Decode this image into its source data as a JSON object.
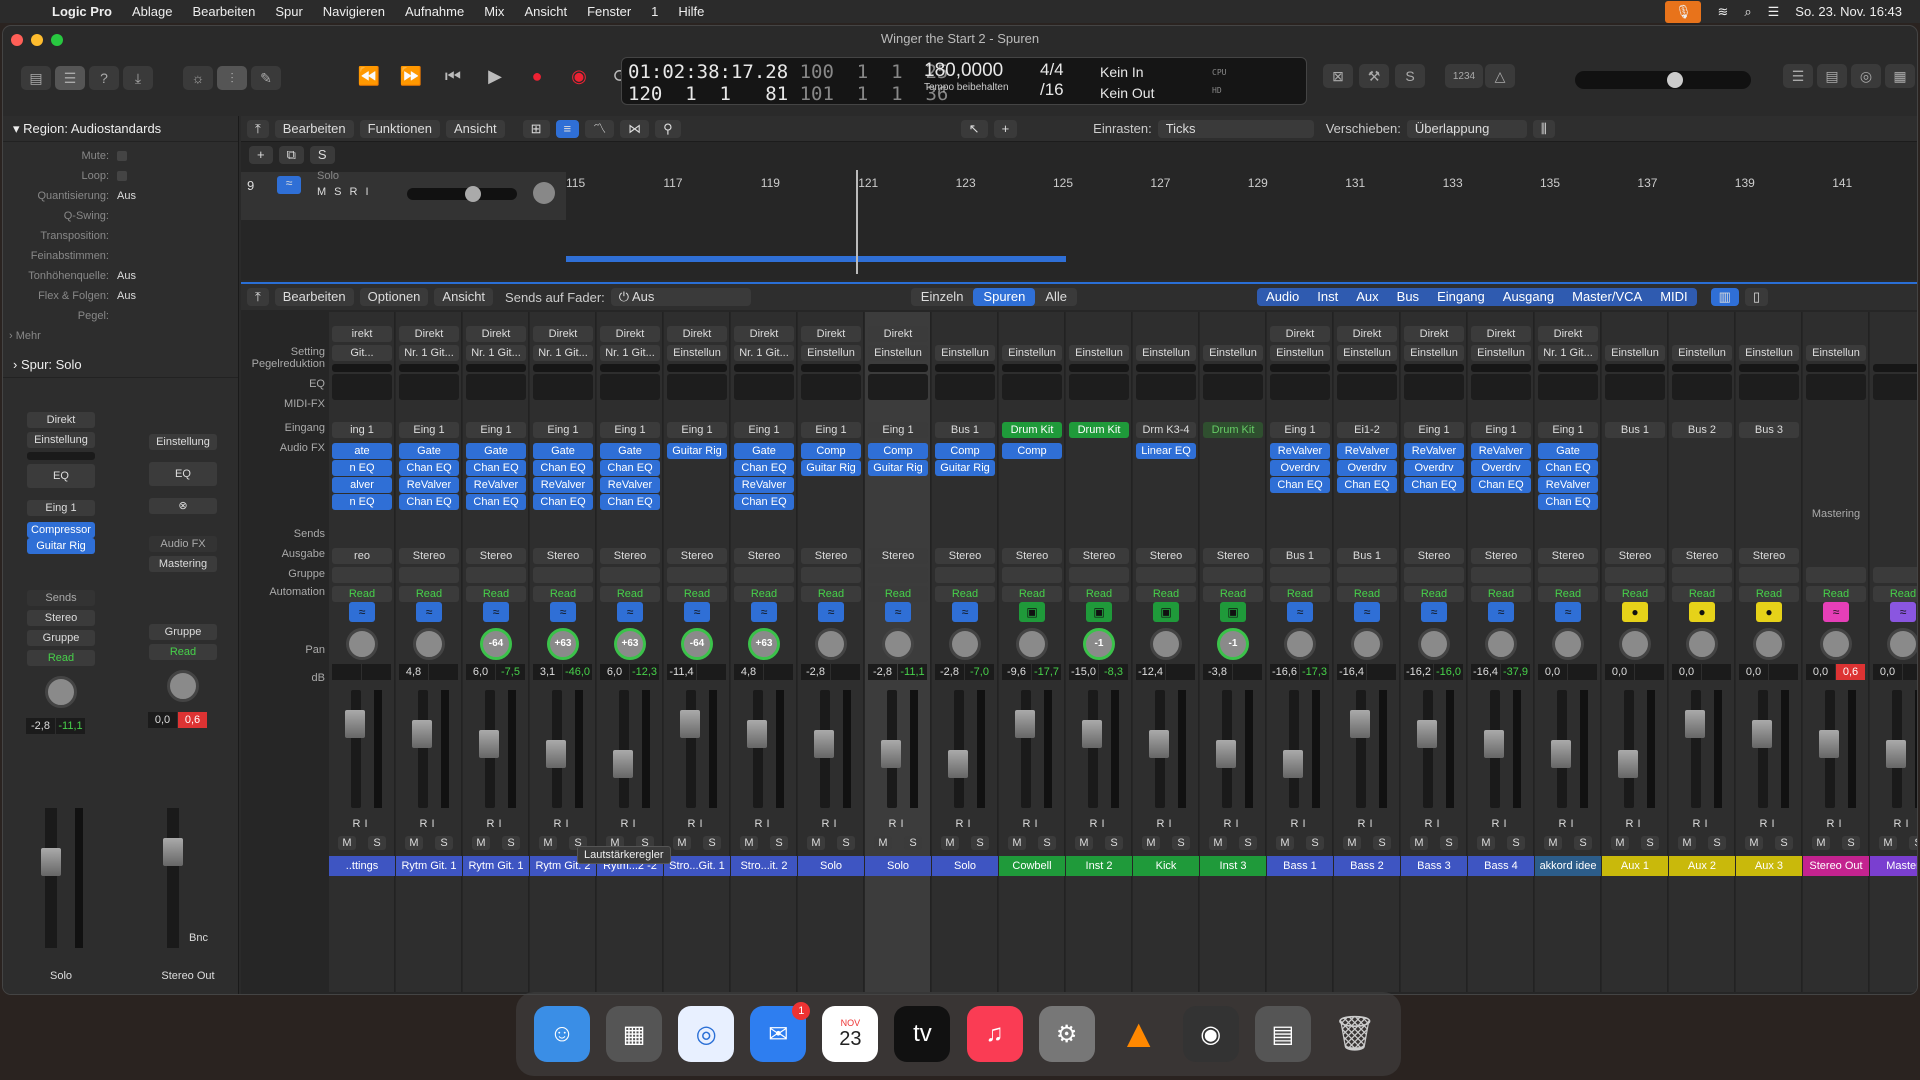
{
  "menubar": {
    "app": "Logic Pro",
    "items": [
      "Ablage",
      "Bearbeiten",
      "Spur",
      "Navigieren",
      "Aufnahme",
      "Mix",
      "Ansicht",
      "Fenster",
      "1",
      "Hilfe"
    ],
    "datetime": "So. 23. Nov.  16:43"
  },
  "window": {
    "title": "Winger the Start 2 - Spuren"
  },
  "lcd": {
    "position": "01:02:38:17.28",
    "bars": "120  1  1   81",
    "bars2a": "100  1  1  25",
    "bars2b": "101  1  1  36",
    "tempo": "180,0000",
    "tempo_mode": "Tempo beibehalten",
    "sig_top": "4/4",
    "sig_bot": "/16",
    "in": "Kein In",
    "out": "Kein Out",
    "cpu": "CPU",
    "hd": "HD"
  },
  "toolbar": {
    "count": "1234"
  },
  "region": {
    "title": "Region: Audiostandards",
    "rows": [
      {
        "k": "Mute:",
        "v": ""
      },
      {
        "k": "Loop:",
        "v": ""
      },
      {
        "k": "Quantisierung:",
        "v": "Aus"
      },
      {
        "k": "Q-Swing:",
        "v": ""
      },
      {
        "k": "Transposition:",
        "v": ""
      },
      {
        "k": "Feinabstimmen:",
        "v": ""
      },
      {
        "k": "Tonhöhenquelle:",
        "v": "Aus"
      },
      {
        "k": "Flex & Folgen:",
        "v": "Aus"
      },
      {
        "k": "Pegel:",
        "v": ""
      }
    ],
    "more": "Mehr",
    "track": "Spur:  Solo"
  },
  "inspector": {
    "s1": {
      "direkt": "Direkt",
      "setting": "Einstellung",
      "eq": "EQ",
      "input": "Eing 1",
      "fx1": "Compressor",
      "fx2": "Guitar Rig",
      "sends": "Sends",
      "out": "Stereo",
      "group": "Gruppe",
      "read": "Read",
      "db1": "-2,8",
      "db2": "-11,1",
      "name": "Solo"
    },
    "s2": {
      "setting": "Einstellung",
      "eq": "EQ",
      "audiofx": "Audio FX",
      "fx1": "Mastering",
      "group": "Gruppe",
      "read": "Read",
      "db1": "0,0",
      "db2": "0,6",
      "bnc": "Bnc",
      "name": "Stereo Out"
    }
  },
  "tracks": {
    "menus": [
      "Bearbeiten",
      "Funktionen",
      "Ansicht"
    ],
    "snap_label": "Einrasten:",
    "snap": "Ticks",
    "move_label": "Verschieben:",
    "move": "Überlappung",
    "track_no": "9",
    "track_name": "Solo",
    "ruler": [
      "115",
      "117",
      "119",
      "121",
      "123",
      "125",
      "127",
      "129",
      "131",
      "133",
      "135",
      "137",
      "139",
      "141"
    ]
  },
  "mixer": {
    "menus": [
      "Bearbeiten",
      "Optionen",
      "Ansicht"
    ],
    "sends_label": "Sends auf Fader:",
    "sends_val": "Aus",
    "views": [
      "Einzeln",
      "Spuren",
      "Alle"
    ],
    "filters": [
      "Audio",
      "Inst",
      "Aux",
      "Bus",
      "Eingang",
      "Ausgang",
      "Master/VCA",
      "MIDI"
    ],
    "labels": [
      "Setting",
      "Pegelreduktion",
      "EQ",
      "MIDI-FX",
      "Eingang",
      "Audio FX",
      "Sends",
      "Ausgabe",
      "Gruppe",
      "Automation",
      "Pan",
      "dB"
    ],
    "tooltip": "Lautstärkeregler",
    "strips": [
      {
        "name": "..ttings",
        "direkt": "irekt",
        "setting": "Git...",
        "input": "ing 1",
        "fx": [
          "ate",
          "n EQ",
          "alver",
          "n EQ"
        ],
        "out": "reo",
        "pan": "",
        "db": [
          "",
          ""
        ],
        "icon": "wave",
        "col": "#3e55c2"
      },
      {
        "name": "Rytm Git. 1",
        "direkt": "Direkt",
        "setting": "Nr. 1 Git...",
        "input": "Eing 1",
        "fx": [
          "Gate",
          "Chan EQ",
          "ReValver",
          "Chan EQ"
        ],
        "out": "Stereo",
        "pan": "",
        "db": [
          "4,8",
          ""
        ],
        "icon": "wave",
        "col": "#3e55c2"
      },
      {
        "name": "Rytm Git. 1",
        "direkt": "Direkt",
        "setting": "Nr. 1 Git...",
        "input": "Eing 1",
        "fx": [
          "Gate",
          "Chan EQ",
          "ReValver",
          "Chan EQ"
        ],
        "out": "Stereo",
        "pan": "-64",
        "db": [
          "6,0",
          "-7,5"
        ],
        "icon": "wave",
        "col": "#3e55c2"
      },
      {
        "name": "Rytm Git. 2",
        "direkt": "Direkt",
        "setting": "Nr. 1 Git...",
        "input": "Eing 1",
        "fx": [
          "Gate",
          "Chan EQ",
          "ReValver",
          "Chan EQ"
        ],
        "out": "Stereo",
        "pan": "+63",
        "db": [
          "3,1",
          "-46,0"
        ],
        "icon": "wave",
        "col": "#3e55c2"
      },
      {
        "name": "Rytm...2 -2",
        "direkt": "Direkt",
        "setting": "Nr. 1 Git...",
        "input": "Eing 1",
        "fx": [
          "Gate",
          "Chan EQ",
          "ReValver",
          "Chan EQ"
        ],
        "out": "Stereo",
        "pan": "+63",
        "db": [
          "6,0",
          "-12,3"
        ],
        "icon": "wave",
        "col": "#3e55c2"
      },
      {
        "name": "Stro...Git. 1",
        "direkt": "Direkt",
        "setting": "Einstellun",
        "input": "Eing 1",
        "fx": [
          "Guitar Rig"
        ],
        "out": "Stereo",
        "pan": "-64",
        "db": [
          "-11,4",
          ""
        ],
        "icon": "wave",
        "col": "#3e55c2"
      },
      {
        "name": "Stro...it. 2",
        "direkt": "Direkt",
        "setting": "Nr. 1 Git...",
        "input": "Eing 1",
        "fx": [
          "Gate",
          "Chan EQ",
          "ReValver",
          "Chan EQ"
        ],
        "out": "Stereo",
        "pan": "+63",
        "db": [
          "4,8",
          ""
        ],
        "icon": "wave",
        "col": "#3e55c2"
      },
      {
        "name": "Solo",
        "direkt": "Direkt",
        "setting": "Einstellun",
        "input": "Eing 1",
        "fx": [
          "Comp",
          "Guitar Rig"
        ],
        "out": "Stereo",
        "pan": "",
        "db": [
          "-2,8",
          ""
        ],
        "icon": "wave",
        "col": "#3e55c2"
      },
      {
        "name": "Solo",
        "direkt": "Direkt",
        "setting": "Einstellun",
        "input": "Eing 1",
        "fx": [
          "Comp",
          "Guitar Rig"
        ],
        "out": "Stereo",
        "pan": "",
        "db": [
          "-2,8",
          "-11,1"
        ],
        "icon": "wave",
        "col": "#3e55c2",
        "sel": true
      },
      {
        "name": "Solo",
        "direkt": "",
        "setting": "Einstellun",
        "input": "Bus 1",
        "fx": [
          "Comp",
          "Guitar Rig"
        ],
        "out": "Stereo",
        "pan": "",
        "db": [
          "-2,8",
          "-7,0"
        ],
        "icon": "wave",
        "col": "#3e55c2"
      },
      {
        "name": "Cowbell",
        "direkt": "",
        "setting": "Einstellun",
        "input": "Drum Kit",
        "inputGreen": true,
        "fx": [
          "Comp"
        ],
        "out": "Stereo",
        "pan": "",
        "db": [
          "-9,6",
          "-17,7"
        ],
        "icon": "drum",
        "col": "#1f9a3a"
      },
      {
        "name": "Inst 2",
        "direkt": "",
        "setting": "Einstellun",
        "input": "Drum Kit",
        "inputGreen": true,
        "fx": [],
        "out": "Stereo",
        "pan": "-1",
        "db": [
          "-15,0",
          "-8,3"
        ],
        "icon": "drum",
        "col": "#1f9a3a"
      },
      {
        "name": "Kick",
        "direkt": "",
        "setting": "Einstellun",
        "input": "Drm K3-4",
        "fx": [
          "Linear EQ"
        ],
        "out": "Stereo",
        "pan": "",
        "db": [
          "-12,4",
          ""
        ],
        "icon": "drum",
        "col": "#1f9a3a"
      },
      {
        "name": "Inst 3",
        "direkt": "",
        "setting": "Einstellun",
        "input": "Drum Kit",
        "inputGreenDim": true,
        "fx": [],
        "out": "Stereo",
        "pan": "-1",
        "db": [
          "-3,8",
          ""
        ],
        "icon": "drum",
        "col": "#1f9a3a"
      },
      {
        "name": "Bass 1",
        "direkt": "Direkt",
        "setting": "Einstellun",
        "input": "Eing 1",
        "fx": [
          "ReValver",
          "Overdrv",
          "Chan EQ"
        ],
        "out": "Bus 1",
        "pan": "",
        "db": [
          "-16,6",
          "-17,3"
        ],
        "icon": "wave",
        "col": "#3e55c2"
      },
      {
        "name": "Bass 2",
        "direkt": "Direkt",
        "setting": "Einstellun",
        "input": "Ei1-2",
        "fx": [
          "ReValver",
          "Overdrv",
          "Chan EQ"
        ],
        "out": "Bus 1",
        "pan": "",
        "db": [
          "-16,4",
          ""
        ],
        "icon": "wave",
        "col": "#3e55c2"
      },
      {
        "name": "Bass 3",
        "direkt": "Direkt",
        "setting": "Einstellun",
        "input": "Eing 1",
        "fx": [
          "ReValver",
          "Overdrv",
          "Chan EQ"
        ],
        "out": "Stereo",
        "pan": "",
        "db": [
          "-16,2",
          "-16,0"
        ],
        "icon": "wave",
        "col": "#3e55c2"
      },
      {
        "name": "Bass 4",
        "direkt": "Direkt",
        "setting": "Einstellun",
        "input": "Eing 1",
        "fx": [
          "ReValver",
          "Overdrv",
          "Chan EQ"
        ],
        "out": "Stereo",
        "pan": "",
        "db": [
          "-16,4",
          "-37,9"
        ],
        "icon": "wave",
        "col": "#3e55c2"
      },
      {
        "name": "akkord idee",
        "direkt": "Direkt",
        "setting": "Nr. 1 Git...",
        "input": "Eing 1",
        "fx": [
          "Gate",
          "Chan EQ",
          "ReValver",
          "Chan EQ"
        ],
        "out": "Stereo",
        "pan": "",
        "db": [
          "0,0",
          ""
        ],
        "icon": "wave",
        "col": "#2c5d8a"
      },
      {
        "name": "Aux 1",
        "direkt": "",
        "setting": "Einstellun",
        "input": "Bus 1",
        "fx": [],
        "out": "Stereo",
        "pan": "",
        "db": [
          "0,0",
          ""
        ],
        "icon": "aux",
        "col": "#c9b90b"
      },
      {
        "name": "Aux 2",
        "direkt": "",
        "setting": "Einstellun",
        "input": "Bus 2",
        "fx": [],
        "out": "Stereo",
        "pan": "",
        "db": [
          "0,0",
          ""
        ],
        "icon": "aux",
        "col": "#c9b90b"
      },
      {
        "name": "Aux 3",
        "direkt": "",
        "setting": "Einstellun",
        "input": "Bus 3",
        "fx": [],
        "out": "Stereo",
        "pan": "",
        "db": [
          "0,0",
          ""
        ],
        "icon": "aux",
        "col": "#c9b90b"
      },
      {
        "name": "Stereo Out",
        "direkt": "",
        "setting": "Einstellun",
        "input": "",
        "fx": [],
        "mastering": "Mastering",
        "out": "",
        "pan": "",
        "db": [
          "0,0",
          "0,6"
        ],
        "icon": "out",
        "col": "#c3238f"
      },
      {
        "name": "Master",
        "direkt": "",
        "setting": "",
        "input": "",
        "fx": [],
        "out": "",
        "pan": "",
        "db": [
          "0,0",
          ""
        ],
        "icon": "master",
        "col": "#7a3fd0"
      }
    ]
  },
  "dock": {
    "calendar_month": "NOV",
    "calendar_day": "23",
    "mail_badge": "1"
  }
}
